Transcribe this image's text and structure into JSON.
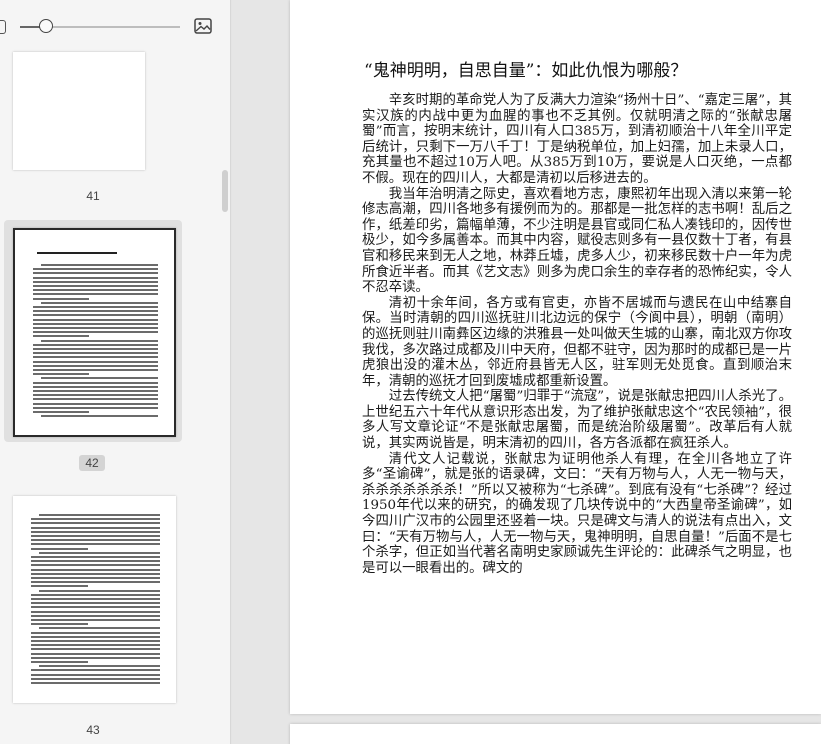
{
  "sidebar": {
    "zoom_level": 0.16,
    "thumbnails": [
      {
        "page_label": "41",
        "selected": false
      },
      {
        "page_label": "42",
        "selected": true
      },
      {
        "page_label": "43",
        "selected": false
      }
    ]
  },
  "document": {
    "title": "“鬼神明明，自思自量”：如此仇恨为哪般？",
    "paragraphs": [
      "辛亥时期的革命党人为了反满大力渲染“扬州十日”、“嘉定三屠”，其实汉族的内战中更为血腥的事也不乏其例。仅就明清之际的“张献忠屠蜀”而言，按明末统计，四川有人口385万，到清初顺治十八年全川平定后统计，只剩下一万八千丁！丁是纳税单位，加上妇孺，加上未录人口，充其量也不超过10万人吧。从385万到10万，要说是人口灭绝，一点都不假。现在的四川人，大都是清初以后移进去的。",
      "我当年治明清之际史，喜欢看地方志，康熙初年出现入清以来第一轮修志高潮，四川各地多有援例而为的。那都是一批怎样的志书啊！乱后之作，纸差印劣，篇幅单薄，不少注明是县官或同仁私人凑钱印的，因传世极少，如今多属善本。而其中内容，赋役志则多有一县仅数十丁者，有县官和移民来到无人之地，林莽丘墟，虎多人少，初来移民数十户一年为虎所食近半者。而其《艺文志》则多为虎口余生的幸存者的恐怖纪实，令人不忍卒读。",
      "清初十余年间，各方或有官吏，亦皆不居城而与遗民在山中结寨自保。当时清朝的四川巡抚驻川北边远的保宁（今阆中县），明朝（南明）的巡抚则驻川南彝区边缘的洪雅县一处叫做天生城的山寨，南北双方你攻我伐，多次路过成都及川中天府，但都不驻守，因为那时的成都已是一片虎狼出没的灌木丛，邻近府县皆无人区，驻军则无处觅食。直到顺治末年，清朝的巡抚才回到废墟成都重新设置。",
      "过去传统文人把“屠蜀”归罪于“流寇”，说是张献忠把四川人杀光了。上世纪五六十年代从意识形态出发，为了维护张献忠这个“农民领袖”，很多人写文章论证“不是张献忠屠蜀，而是统治阶级屠蜀”。改革后有人就说，其实两说皆是，明末清初的四川，各方各派都在疯狂杀人。",
      "清代文人记载说，张献忠为证明他杀人有理，在全川各地立了许多“圣谕碑”，就是张的语录碑，文曰：“天有万物与人，人无一物与天，杀杀杀杀杀杀杀！”所以又被称为“七杀碑”。到底有没有“七杀碑”？经过1950年代以来的研究，的确发现了几块传说中的“大西皇帝圣谕碑”，如今四川广汉市的公园里还竖着一块。只是碑文与清人的说法有点出入，文曰：“天有万物与人，人无一物与天，鬼神明明，自思自量！”后面不是七个杀字，但正如当代著名南明史家顾诚先生评论的：此碑杀气之明显，也是可以一眼看出的。碑文的"
    ]
  }
}
